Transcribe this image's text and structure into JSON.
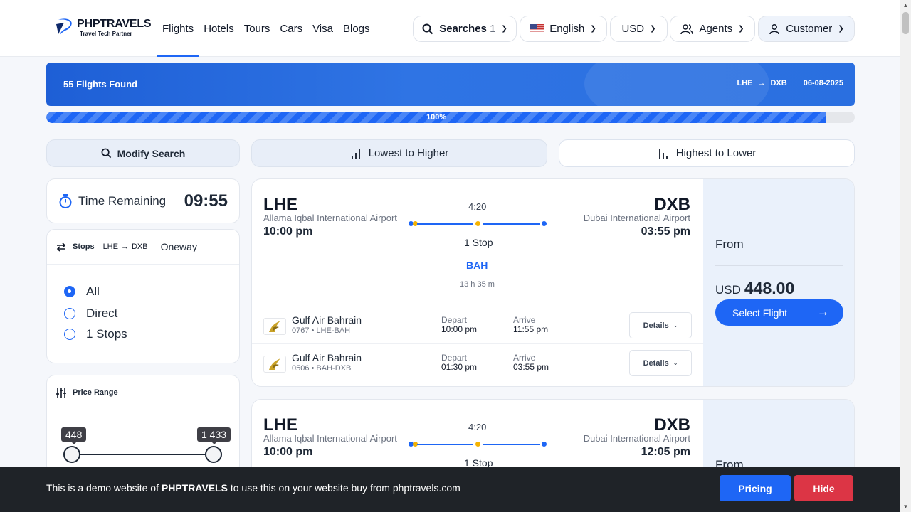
{
  "brand": {
    "name": "PHPTRAVELS",
    "tagline": "Travel Tech Partner",
    "accent": "#1e66f5"
  },
  "nav": [
    "Flights",
    "Hotels",
    "Tours",
    "Cars",
    "Visa",
    "Blogs"
  ],
  "header": {
    "searches_label": "Searches",
    "searches_count": "1",
    "language": "English",
    "currency": "USD",
    "agents": "Agents",
    "customer": "Customer"
  },
  "banner": {
    "count": "55 Flights Found",
    "from": "LHE",
    "to": "DXB",
    "date": "06-08-2025"
  },
  "progress": {
    "label": "100%",
    "value": 0.965
  },
  "sort": {
    "modify": "Modify Search",
    "low": "Lowest to Higher",
    "high": "Highest to Lower"
  },
  "timer": {
    "label": "Time Remaining",
    "value": "09:55"
  },
  "stops": {
    "title": "Stops",
    "from": "LHE",
    "to": "DXB",
    "trip": "Oneway",
    "options": [
      "All",
      "Direct",
      "1 Stops"
    ],
    "selected": "All"
  },
  "price_range": {
    "title": "Price Range",
    "min": "448",
    "max": "1 433"
  },
  "flights": [
    {
      "from_code": "LHE",
      "from_airport": "Allama Iqbal International Airport",
      "dep_time": "10:00 pm",
      "to_code": "DXB",
      "to_airport": "Dubai International Airport",
      "arr_time": "03:55 pm",
      "duration": "4:20",
      "stops": "1 Stop",
      "via": "BAH",
      "total": "13 h 35 m",
      "from_label": "From",
      "currency": "USD",
      "price": "448.00",
      "select": "Select Flight",
      "legs": [
        {
          "airline": "Gulf Air Bahrain",
          "number": "0767 • LHE-BAH",
          "depart_label": "Depart",
          "depart": "10:00 pm",
          "arrive_label": "Arrive",
          "arrive": "11:55 pm",
          "details": "Details"
        },
        {
          "airline": "Gulf Air Bahrain",
          "number": "0506 • BAH-DXB",
          "depart_label": "Depart",
          "depart": "01:30 pm",
          "arrive_label": "Arrive",
          "arrive": "03:55 pm",
          "details": "Details"
        }
      ]
    },
    {
      "from_code": "LHE",
      "from_airport": "Allama Iqbal International Airport",
      "dep_time": "10:00 pm",
      "to_code": "DXB",
      "to_airport": "Dubai International Airport",
      "arr_time": "12:05 pm",
      "duration": "4:20",
      "stops": "1 Stop",
      "from_label": "From"
    }
  ],
  "footer": {
    "text_before": "This is a demo website of ",
    "brand": "PHPTRAVELS",
    "text_after": " to use this on your website buy from phptravels.com",
    "pricing": "Pricing",
    "hide": "Hide"
  }
}
